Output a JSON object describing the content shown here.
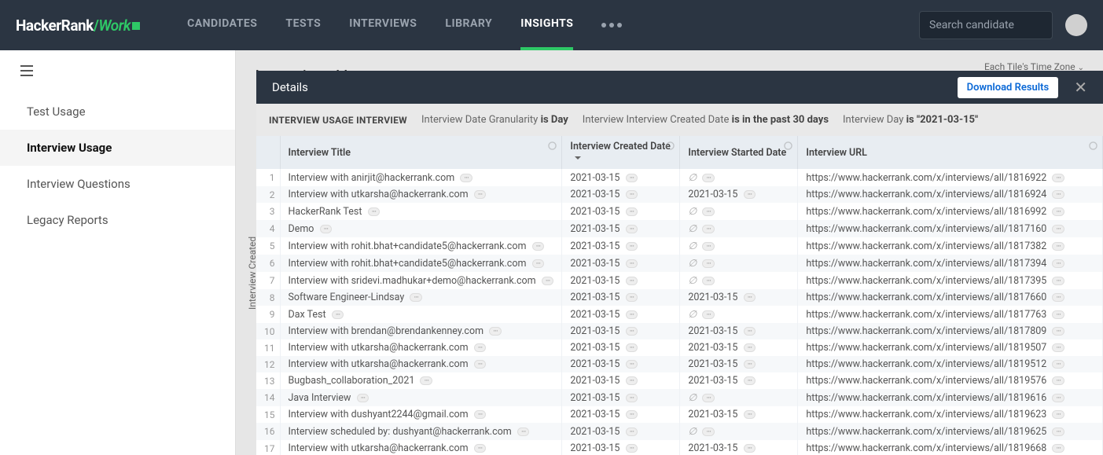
{
  "logo": {
    "p1": "HackerRank",
    "p2": "Work"
  },
  "nav": [
    "CANDIDATES",
    "TESTS",
    "INTERVIEWS",
    "LIBRARY",
    "INSIGHTS"
  ],
  "nav_active": 4,
  "search_placeholder": "Search candidate",
  "sidebar": [
    "Test Usage",
    "Interview Usage",
    "Interview Questions",
    "Legacy Reports"
  ],
  "sidebar_active": 1,
  "page_title": "Interview Usage",
  "timezone": "Each Tile's Time Zone",
  "modal": {
    "title": "Details",
    "download": "Download Results",
    "filter_tag": "INTERVIEW USAGE INTERVIEW",
    "filters": [
      {
        "t": "Interview Date Granularity ",
        "b": "is Day"
      },
      {
        "t": "Interview Interview Created Date ",
        "b": "is in the past 30 days"
      },
      {
        "t": "Interview Day ",
        "b": "is \"2021-03-15\""
      }
    ],
    "cols": [
      "Interview Title",
      "Interview Created Date",
      "Interview Started Date",
      "Interview URL"
    ],
    "rows": [
      {
        "title": "Interview with anirjit@hackerrank.com",
        "created": "2021-03-15",
        "started": null,
        "url": "https://www.hackerrank.com/x/interviews/all/1816922"
      },
      {
        "title": "Interview with utkarsha@hackerrank.com",
        "created": "2021-03-15",
        "started": "2021-03-15",
        "url": "https://www.hackerrank.com/x/interviews/all/1816924"
      },
      {
        "title": "HackerRank Test",
        "created": "2021-03-15",
        "started": null,
        "url": "https://www.hackerrank.com/x/interviews/all/1816992"
      },
      {
        "title": "Demo",
        "created": "2021-03-15",
        "started": null,
        "url": "https://www.hackerrank.com/x/interviews/all/1817160"
      },
      {
        "title": "Interview with rohit.bhat+candidate5@hackerrank.com",
        "created": "2021-03-15",
        "started": null,
        "url": "https://www.hackerrank.com/x/interviews/all/1817382"
      },
      {
        "title": "Interview with rohit.bhat+candidate5@hackerrank.com",
        "created": "2021-03-15",
        "started": null,
        "url": "https://www.hackerrank.com/x/interviews/all/1817394"
      },
      {
        "title": "Interview with sridevi.madhukar+demo@hackerrank.com",
        "created": "2021-03-15",
        "started": null,
        "url": "https://www.hackerrank.com/x/interviews/all/1817395"
      },
      {
        "title": "Software Engineer-Lindsay",
        "created": "2021-03-15",
        "started": "2021-03-15",
        "url": "https://www.hackerrank.com/x/interviews/all/1817660"
      },
      {
        "title": "Dax Test",
        "created": "2021-03-15",
        "started": null,
        "url": "https://www.hackerrank.com/x/interviews/all/1817763"
      },
      {
        "title": "Interview with brendan@brendankenney.com",
        "created": "2021-03-15",
        "started": "2021-03-15",
        "url": "https://www.hackerrank.com/x/interviews/all/1817809"
      },
      {
        "title": "Interview with utkarsha@hackerrank.com",
        "created": "2021-03-15",
        "started": "2021-03-15",
        "url": "https://www.hackerrank.com/x/interviews/all/1819507"
      },
      {
        "title": "Interview with utkarsha@hackerrank.com",
        "created": "2021-03-15",
        "started": "2021-03-15",
        "url": "https://www.hackerrank.com/x/interviews/all/1819512"
      },
      {
        "title": "Bugbash_collaboration_2021",
        "created": "2021-03-15",
        "started": "2021-03-15",
        "url": "https://www.hackerrank.com/x/interviews/all/1819576"
      },
      {
        "title": "Java Interview",
        "created": "2021-03-15",
        "started": null,
        "url": "https://www.hackerrank.com/x/interviews/all/1819616"
      },
      {
        "title": "Interview with dushyant2244@gmail.com",
        "created": "2021-03-15",
        "started": "2021-03-15",
        "url": "https://www.hackerrank.com/x/interviews/all/1819623"
      },
      {
        "title": "Interview scheduled by: dushyant@hackerrank.com",
        "created": "2021-03-15",
        "started": null,
        "url": "https://www.hackerrank.com/x/interviews/all/1819625"
      },
      {
        "title": "Interview with utkarsha@hackerrank.com",
        "created": "2021-03-15",
        "started": "2021-03-15",
        "url": "https://www.hackerrank.com/x/interviews/all/1819668"
      }
    ]
  },
  "vlabel": "Interview Created"
}
